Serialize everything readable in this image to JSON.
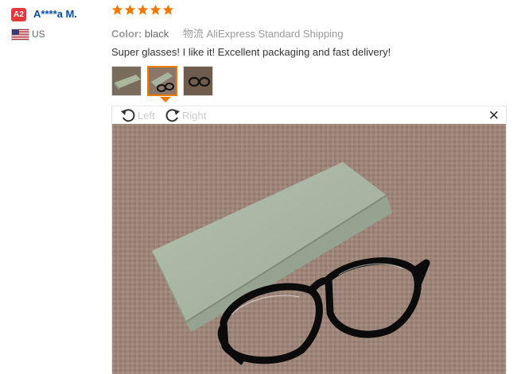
{
  "reviewer": {
    "badge": "A2",
    "name": "A****a M.",
    "country": "US",
    "flag_icon": "us-flag-icon"
  },
  "rating": {
    "stars": 5,
    "max": 5,
    "color": "#f07a00"
  },
  "order_meta": {
    "color_label": "Color:",
    "color_value": "black",
    "shipping_label": "物流",
    "shipping_value": "AliExpress Standard Shipping"
  },
  "review": {
    "text": "Super glasses! I like it! Excellent packaging and fast delivery!"
  },
  "thumbnails": [
    {
      "name": "thumbnail-case-closed",
      "active": false
    },
    {
      "name": "thumbnail-case-glasses",
      "active": true
    },
    {
      "name": "thumbnail-glasses",
      "active": false
    }
  ],
  "viewer": {
    "rotate_left_label": "Left",
    "rotate_right_label": "Right",
    "close_glyph": "✕",
    "accent": "#f07a00"
  }
}
